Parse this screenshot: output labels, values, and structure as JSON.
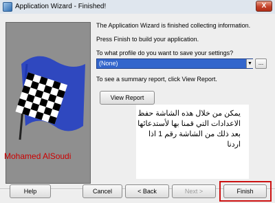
{
  "window": {
    "title": "Application Wizard - Finished!",
    "close_label": "X"
  },
  "info": {
    "line1": "The Application Wizard is finished collecting information.",
    "line2": "Press Finish to build your application.",
    "profile_prompt": "To what profile do you want to save your settings?",
    "profile_value": "(None)",
    "profile_browse_label": "...",
    "summary_prompt": "To see a summary report, click View Report.",
    "view_report_label": "View Report"
  },
  "annotation": {
    "arabic_text": "يمكن من خلال هذه الشاشة حفظ الاعدادات التي قمنا بها لأستدعائها بعد ذلك من الشاشة رقم 1 اذا اردنا",
    "signature": "Mohamed AlSoudi"
  },
  "buttons": {
    "help": "Help",
    "cancel": "Cancel",
    "back": "< Back",
    "next": "Next >",
    "finish": "Finish"
  },
  "colors": {
    "selection_blue": "#3366cc",
    "highlight_red": "#cc1111",
    "signature_red": "#cc0000"
  }
}
